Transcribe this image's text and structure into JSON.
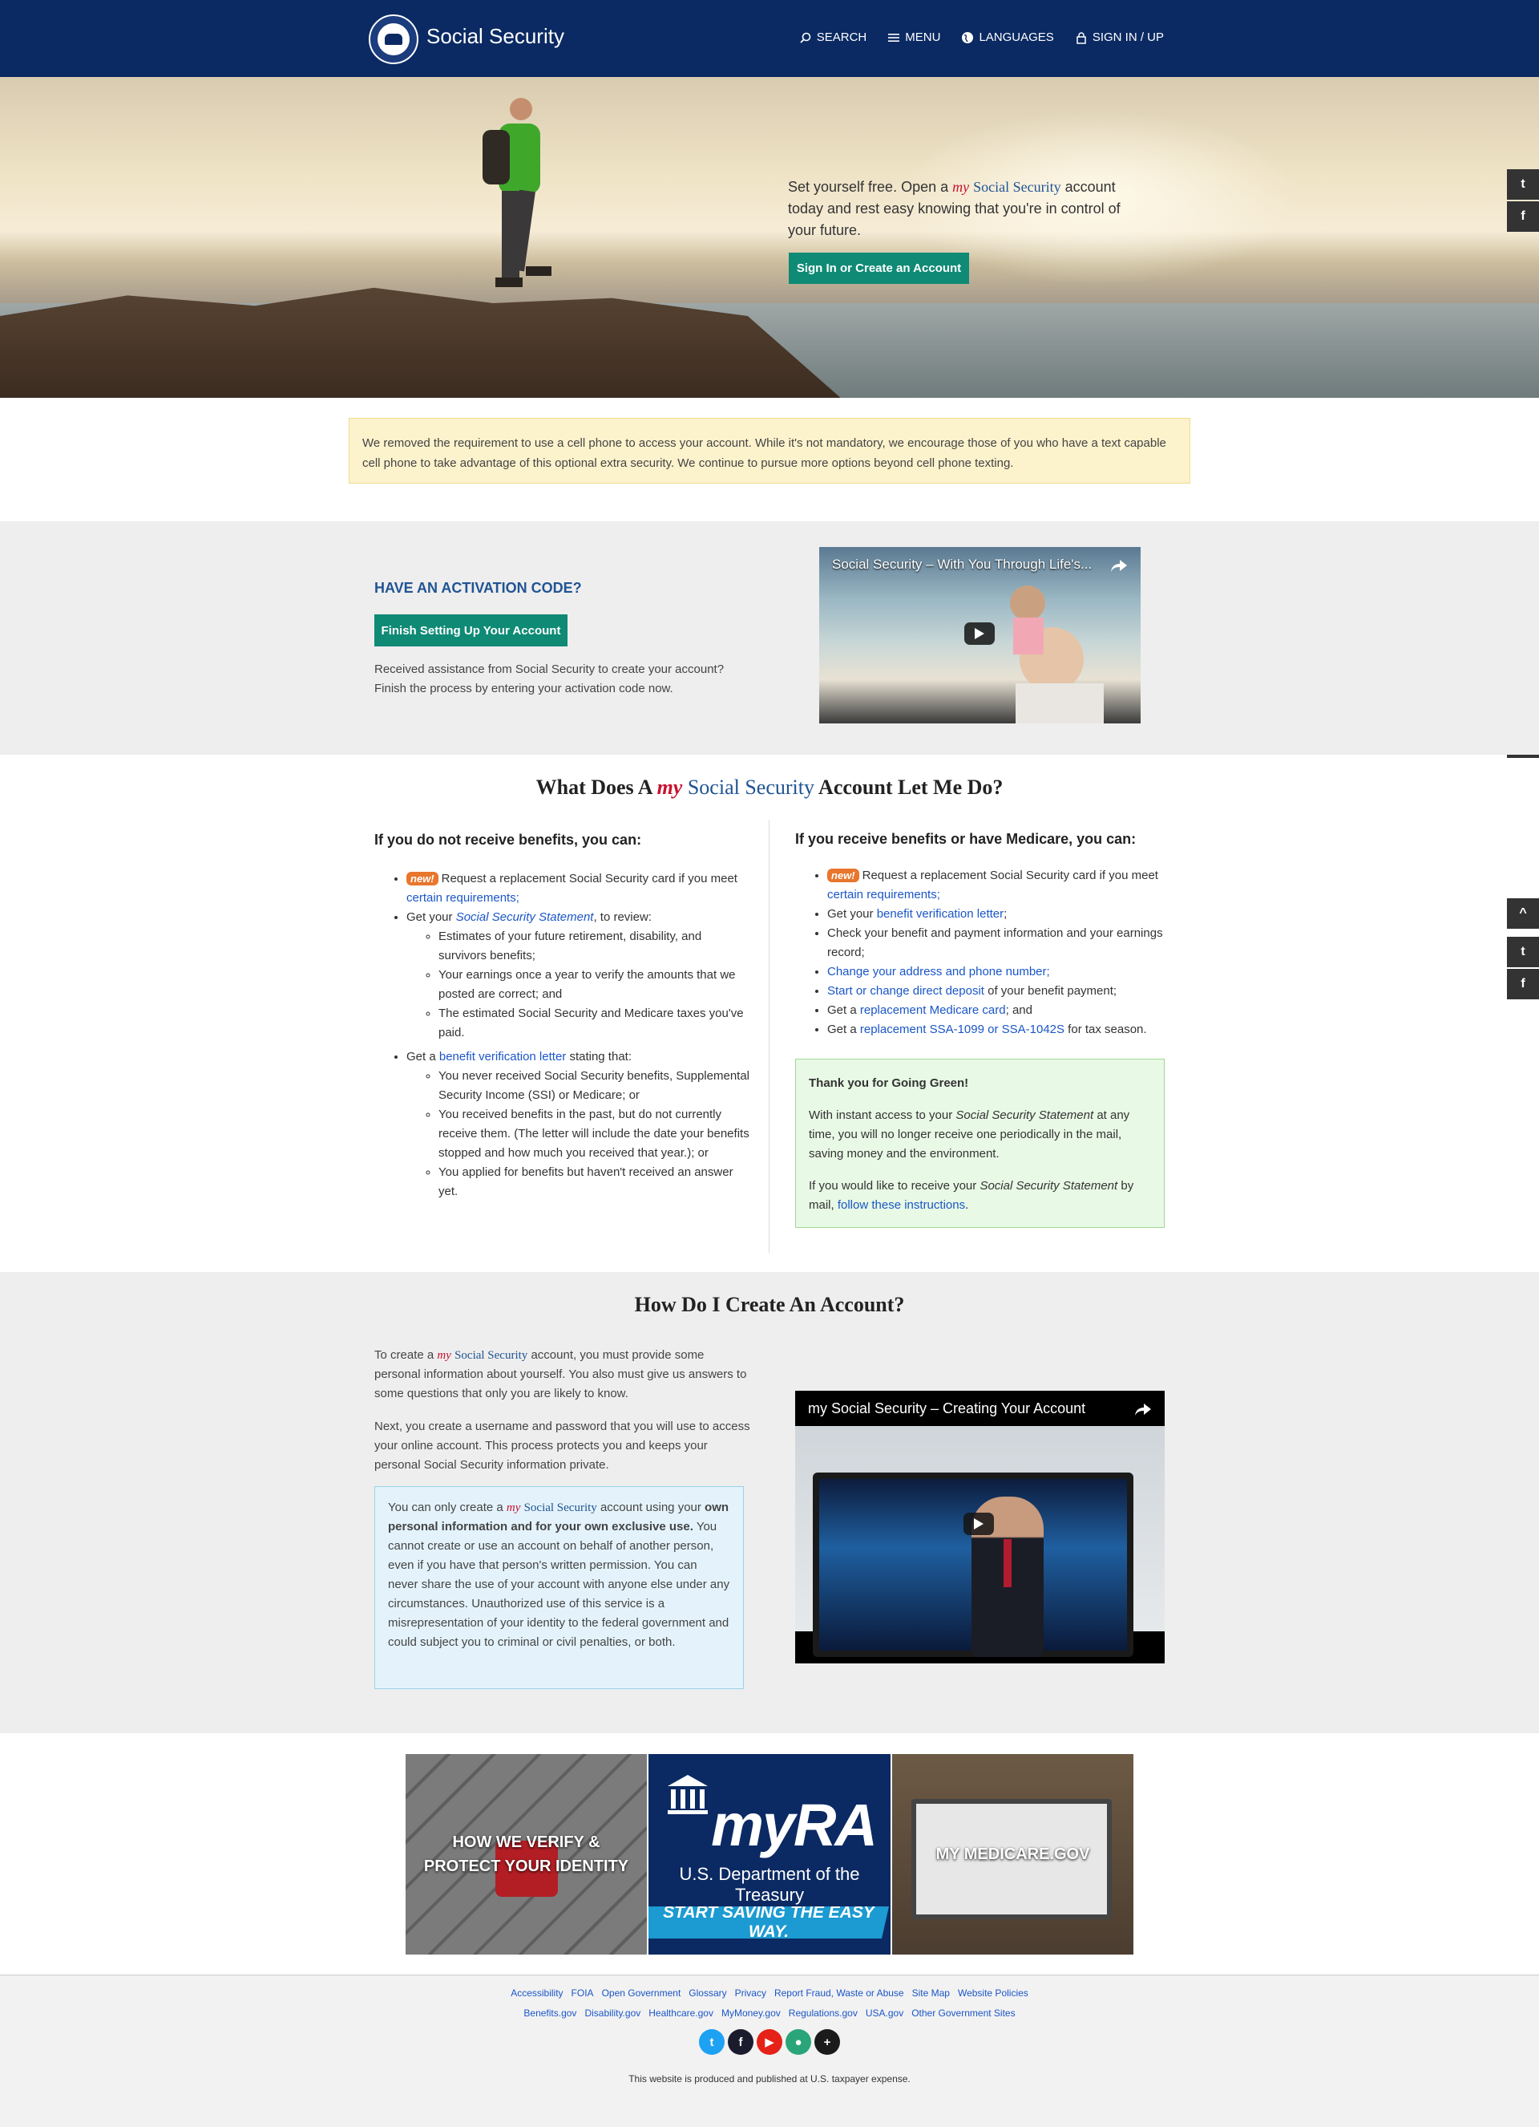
{
  "header": {
    "brand": "Social Security",
    "nav": {
      "search": "SEARCH",
      "menu": "MENU",
      "languages": "LANGUAGES",
      "signin": "SIGN IN / UP"
    }
  },
  "hero": {
    "text_pre": "Set yourself free. Open a ",
    "my": "my",
    "ss": "Social Security",
    "text_post": " account today and rest easy knowing that you're in control of your future.",
    "button": "Sign In or Create an Account"
  },
  "alert": "We removed the requirement to use a cell phone to access your account. While it's not mandatory, we encourage those of you who have a text capable cell phone to take advantage of this optional extra security. We continue to pursue more options beyond cell phone texting.",
  "activation": {
    "title": "HAVE AN ACTIVATION CODE?",
    "button": "Finish Setting Up Your Account",
    "text": "Received assistance from Social Security to create your account? Finish the process by entering your activation code now.",
    "video_title": "Social Security – With You Through Life's..."
  },
  "what": {
    "title_pre": "What Does A ",
    "title_my": "my",
    "title_ss": "Social Security",
    "title_post": " Account Let Me Do?",
    "left_heading": "If you do not receive benefits, you can:",
    "right_heading": "If you receive benefits or have Medicare, you can:",
    "new_badge": "new!",
    "left": {
      "item1_pre": "Request a replacement Social Security card if you meet ",
      "item1_link": "certain requirements;",
      "item2_pre": "Get your ",
      "item2_link": "Social Security Statement",
      "item2_post": ", to review:",
      "item2_sub1": "Estimates of your future retirement, disability, and survivors benefits;",
      "item2_sub2": "Your earnings once a year to verify the amounts that we posted are correct; and",
      "item2_sub3": "The estimated Social Security and Medicare taxes you've paid.",
      "item3_pre": "Get a ",
      "item3_link": "benefit verification letter",
      "item3_post": " stating that:",
      "item3_sub1": "You never received Social Security benefits, Supplemental Security Income (SSI) or Medicare; or",
      "item3_sub2": "You received benefits in the past, but do not currently receive them. (The letter will include the date your benefits stopped and how much you received that year.); or",
      "item3_sub3": "You applied for benefits but haven't received an answer yet."
    },
    "right": {
      "item1_pre": "Request a replacement Social Security card if you meet ",
      "item1_link": "certain requirements;",
      "item2_pre": "Get your ",
      "item2_link": "benefit verification letter",
      "item2_post": ";",
      "item3": "Check your benefit and payment information and your earnings record;",
      "item4_link": "Change your address and phone number;",
      "item5_link": "Start or change direct deposit",
      "item5_post": " of your benefit payment;",
      "item6_pre": "Get a ",
      "item6_link": "replacement Medicare card",
      "item6_post": "; and",
      "item7_pre": "Get a ",
      "item7_link": "replacement SSA-1099 or SSA-1042S",
      "item7_post": " for tax season."
    },
    "green": {
      "title": "Thank you for Going Green!",
      "p1_pre": "With instant access to your ",
      "p1_em": "Social Security Statement",
      "p1_post": " at any time, you will no longer receive one periodically in the mail, saving money and the environment.",
      "p2_pre": "If you would like to receive your ",
      "p2_em": "Social Security Statement",
      "p2_mid": " by mail, ",
      "p2_link": "follow these instructions",
      "p2_post": "."
    }
  },
  "create": {
    "title": "How Do I Create An Account?",
    "p1_pre": "To create a ",
    "p1_my": "my",
    "p1_ss": "Social Security",
    "p1_post": " account, you must provide some personal information about yourself. You also must give us answers to some questions that only you are likely to know.",
    "p2": "Next, you create a username and password that you will use to access your online account. This process protects you and keeps your personal Social Security information private.",
    "box_pre": "You can only create a ",
    "box_my": "my",
    "box_ss": "Social Security",
    "box_mid": " account using your ",
    "box_bold": "own personal information and for your own exclusive use.",
    "box_post": "  You cannot create or use an account on behalf of another person, even if you have that person's written permission. You can never share the use of your account with anyone else under any circumstances. Unauthorized use of this service is a misrepresentation of your identity to the federal government and could subject you to criminal or civil penalties, or both.",
    "video_title": "my Social Security – Creating Your Account"
  },
  "tiles": {
    "verify": "HOW WE VERIFY & PROTECT YOUR IDENTITY",
    "myra": "myRA",
    "treasury": "U.S. Department of the Treasury",
    "saving": "START SAVING THE EASY WAY.",
    "medicare": "MY MEDICARE.GOV"
  },
  "footer": {
    "row1": [
      "Accessibility",
      "FOIA",
      "Open Government",
      "Glossary",
      "Privacy",
      "Report Fraud, Waste or Abuse",
      "Site Map",
      "Website Policies"
    ],
    "row2": [
      "Benefits.gov",
      "Disability.gov",
      "Healthcare.gov",
      "MyMoney.gov",
      "Regulations.gov",
      "USA.gov",
      "Other Government Sites"
    ],
    "note": "This website is produced and published at U.S. taxpayer expense."
  },
  "colors": {
    "navy": "#0b2a63",
    "teal": "#0e8a75",
    "link": "#1a56c8",
    "red": "#c8102e"
  }
}
